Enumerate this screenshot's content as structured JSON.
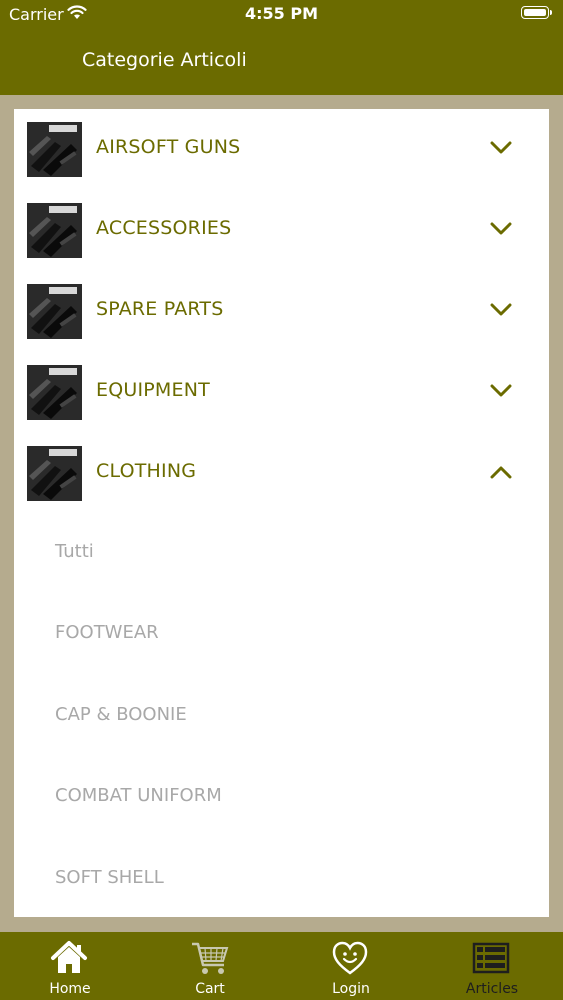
{
  "status_bar": {
    "carrier": "Carrier",
    "time": "4:55 PM"
  },
  "header": {
    "title": "Categorie Articoli"
  },
  "categories": [
    {
      "label": "AIRSOFT GUNS",
      "expanded": false
    },
    {
      "label": "ACCESSORIES",
      "expanded": false
    },
    {
      "label": "SPARE PARTS",
      "expanded": false
    },
    {
      "label": "EQUIPMENT",
      "expanded": false
    },
    {
      "label": "CLOTHING",
      "expanded": true
    }
  ],
  "subcategories": [
    {
      "label": "Tutti"
    },
    {
      "label": "FOOTWEAR"
    },
    {
      "label": "CAP & BOONIE"
    },
    {
      "label": "COMBAT UNIFORM"
    },
    {
      "label": "SOFT SHELL"
    }
  ],
  "tabbar": {
    "tabs": [
      {
        "label": "Home",
        "icon": "home-icon"
      },
      {
        "label": "Cart",
        "icon": "cart-icon"
      },
      {
        "label": "Login",
        "icon": "heart-smile-icon"
      },
      {
        "label": "Articles",
        "icon": "list-icon",
        "active": true
      }
    ]
  },
  "colors": {
    "header_bg": "#6b6b00",
    "accent_text": "#6b6b00",
    "page_bg": "#b5ab8e",
    "sub_text": "#a8a8a8"
  }
}
